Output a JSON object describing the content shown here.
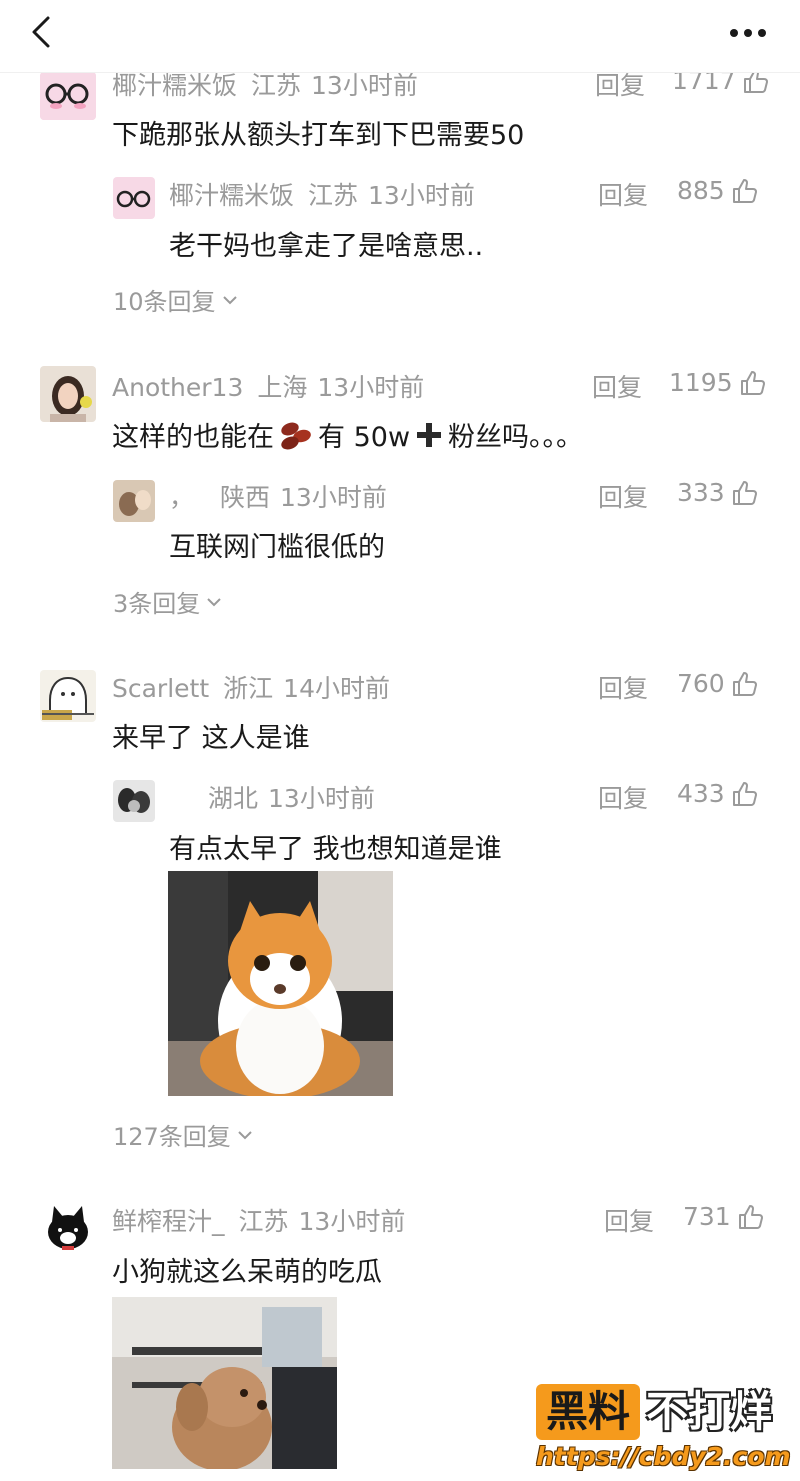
{
  "topbar": {
    "back_icon": "chevron-left-icon",
    "more_icon": "more-dots-icon"
  },
  "comments": [
    {
      "name": "椰汁糯米饭",
      "location": "江苏",
      "time": "13小时前",
      "reply_label": "回复",
      "likes": "1717",
      "text": "下跪那张从额头打车到下巴需要50",
      "replies": [
        {
          "name": "椰汁糯米饭",
          "location": "江苏",
          "time": "13小时前",
          "reply_label": "回复",
          "likes": "885",
          "text": "老干妈也拿走了是啥意思.."
        }
      ],
      "more_replies": "10条回复"
    },
    {
      "name": "Another13",
      "location": "上海",
      "time": "13小时前",
      "reply_label": "回复",
      "likes": "1195",
      "text_before": "这样的也能在",
      "text_after": "有 50w",
      "text_end": "粉丝吗。。。",
      "replies": [
        {
          "name": "，",
          "location": "陕西",
          "time": "13小时前",
          "reply_label": "回复",
          "likes": "333",
          "text": "互联网门槛很低的"
        }
      ],
      "more_replies": "3条回复"
    },
    {
      "name": "Scarlett",
      "location": "浙江",
      "time": "14小时前",
      "reply_label": "回复",
      "likes": "760",
      "text": "来早了 这人是谁",
      "replies": [
        {
          "name": "",
          "location": "湖北",
          "time": "13小时前",
          "reply_label": "回复",
          "likes": "433",
          "text": "有点太早了 我也想知道是谁"
        }
      ],
      "more_replies": "127条回复"
    },
    {
      "name": "鲜榨程汁_",
      "location": "江苏",
      "time": "13小时前",
      "reply_label": "回复",
      "likes": "731",
      "text": "小狗就这么呆萌的吃瓜"
    }
  ],
  "watermark": {
    "box_text": "黑料",
    "right_text": "不打烊",
    "url": "https://cbdy2.com"
  },
  "colors": {
    "meta_gray": "#9a9a9a",
    "text": "#1a1a1a",
    "watermark_orange": "#f59a1c"
  }
}
